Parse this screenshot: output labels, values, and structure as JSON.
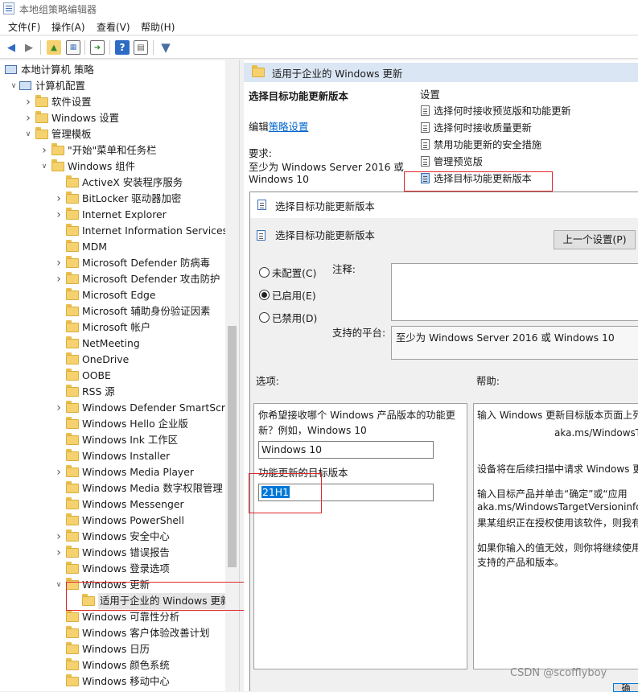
{
  "window": {
    "title": "本地组策略编辑器"
  },
  "menu": [
    "文件(F)",
    "操作(A)",
    "查看(V)",
    "帮助(H)"
  ],
  "toolbar": {
    "icons": [
      "back-arrow-icon",
      "forward-arrow-icon",
      "up-folder-icon",
      "show-hide-tree-icon",
      "export-list-icon",
      "help-icon",
      "properties-icon",
      "filter-icon"
    ]
  },
  "tree": {
    "items": [
      {
        "label": "本地计算机 策略",
        "level": 0,
        "expand": "",
        "icon": "computer"
      },
      {
        "label": "计算机配置",
        "level": 1,
        "expand": "v",
        "icon": "computer"
      },
      {
        "label": "软件设置",
        "level": 2,
        "expand": ">",
        "icon": "folder"
      },
      {
        "label": "Windows 设置",
        "level": 2,
        "expand": ">",
        "icon": "folder"
      },
      {
        "label": "管理模板",
        "level": 2,
        "expand": "v",
        "icon": "folder"
      },
      {
        "label": "\"开始\"菜单和任务栏",
        "level": 3,
        "expand": ">",
        "icon": "folder"
      },
      {
        "label": "Windows 组件",
        "level": 3,
        "expand": "v",
        "icon": "folder"
      },
      {
        "label": "ActiveX 安装程序服务",
        "level": 4,
        "expand": "",
        "icon": "folder"
      },
      {
        "label": "BitLocker 驱动器加密",
        "level": 4,
        "expand": ">",
        "icon": "folder"
      },
      {
        "label": "Internet Explorer",
        "level": 4,
        "expand": ">",
        "icon": "folder"
      },
      {
        "label": "Internet Information Services",
        "level": 4,
        "expand": "",
        "icon": "folder"
      },
      {
        "label": "MDM",
        "level": 4,
        "expand": "",
        "icon": "folder"
      },
      {
        "label": "Microsoft Defender 防病毒",
        "level": 4,
        "expand": ">",
        "icon": "folder"
      },
      {
        "label": "Microsoft Defender 攻击防护",
        "level": 4,
        "expand": ">",
        "icon": "folder"
      },
      {
        "label": "Microsoft Edge",
        "level": 4,
        "expand": "",
        "icon": "folder"
      },
      {
        "label": "Microsoft 辅助身份验证因素",
        "level": 4,
        "expand": "",
        "icon": "folder"
      },
      {
        "label": "Microsoft 帐户",
        "level": 4,
        "expand": "",
        "icon": "folder"
      },
      {
        "label": "NetMeeting",
        "level": 4,
        "expand": "",
        "icon": "folder"
      },
      {
        "label": "OneDrive",
        "level": 4,
        "expand": "",
        "icon": "folder"
      },
      {
        "label": "OOBE",
        "level": 4,
        "expand": "",
        "icon": "folder"
      },
      {
        "label": "RSS 源",
        "level": 4,
        "expand": "",
        "icon": "folder"
      },
      {
        "label": "Windows Defender SmartScree",
        "level": 4,
        "expand": ">",
        "icon": "folder"
      },
      {
        "label": "Windows Hello 企业版",
        "level": 4,
        "expand": "",
        "icon": "folder"
      },
      {
        "label": "Windows Ink 工作区",
        "level": 4,
        "expand": "",
        "icon": "folder"
      },
      {
        "label": "Windows Installer",
        "level": 4,
        "expand": "",
        "icon": "folder"
      },
      {
        "label": "Windows Media Player",
        "level": 4,
        "expand": ">",
        "icon": "folder"
      },
      {
        "label": "Windows Media 数字权限管理",
        "level": 4,
        "expand": "",
        "icon": "folder"
      },
      {
        "label": "Windows Messenger",
        "level": 4,
        "expand": "",
        "icon": "folder"
      },
      {
        "label": "Windows PowerShell",
        "level": 4,
        "expand": "",
        "icon": "folder"
      },
      {
        "label": "Windows 安全中心",
        "level": 4,
        "expand": ">",
        "icon": "folder"
      },
      {
        "label": "Windows 错误报告",
        "level": 4,
        "expand": ">",
        "icon": "folder"
      },
      {
        "label": "Windows 登录选项",
        "level": 4,
        "expand": "",
        "icon": "folder"
      },
      {
        "label": "Windows 更新",
        "level": 4,
        "expand": "v",
        "icon": "folder"
      },
      {
        "label": "适用于企业的 Windows 更新",
        "level": 5,
        "expand": "",
        "icon": "folder",
        "selected": true
      },
      {
        "label": "Windows 可靠性分析",
        "level": 4,
        "expand": "",
        "icon": "folder"
      },
      {
        "label": "Windows 客户体验改善计划",
        "level": 4,
        "expand": "",
        "icon": "folder"
      },
      {
        "label": "Windows 日历",
        "level": 4,
        "expand": "",
        "icon": "folder"
      },
      {
        "label": "Windows 颜色系统",
        "level": 4,
        "expand": "",
        "icon": "folder"
      },
      {
        "label": "Windows 移动中心",
        "level": 4,
        "expand": "",
        "icon": "folder"
      }
    ]
  },
  "right": {
    "header": "适用于企业的 Windows 更新",
    "policy_title": "选择目标功能更新版本",
    "edit_prefix": "编辑",
    "edit_link": "策略设置",
    "req_label": "要求:",
    "req_text_1": "至少为 Windows Server 2016 或",
    "req_text_2": "Windows 10",
    "settings_header": "设置",
    "settings": [
      "选择何时接收预览版和功能更新",
      "选择何时接收质量更新",
      "禁用功能更新的安全措施",
      "管理预览版",
      "选择目标功能更新版本"
    ]
  },
  "dialog": {
    "window_title": "选择目标功能更新版本",
    "setting_title": "选择目标功能更新版本",
    "prev_button": "上一个设置(P)",
    "radios": [
      "未配置(C)",
      "已启用(E)",
      "已禁用(D)"
    ],
    "selected_radio": "已启用(E)",
    "comment_label": "注释:",
    "platform_label": "支持的平台:",
    "platform_value": "至少为 Windows Server 2016 或 Windows 10",
    "options_label": "选项:",
    "help_label": "帮助:",
    "option_desc": "你希望接收哪个 Windows 产品版本的功能更新？例如，Windows 10",
    "product_value": "Windows 10",
    "target_label": "功能更新的目标版本",
    "target_value": "21H1",
    "help_lines": [
      "输入 Windows 更新目标版本页面上列",
      "aka.ms/WindowsT",
      "设备将在后续扫描中请求 Windows 更",
      "输入目标产品并单击“确定”或“应用",
      "aka.ms/WindowsTargetVersioninfo",
      "果某组织正在授权使用该软件，则我有",
      "如果你输入的值无效，则你将继续使用",
      "支持的产品和版本。"
    ],
    "ok_partial": "确"
  },
  "watermark": "CSDN @scofflyboy",
  "colors": {
    "highlight": "#0078d7",
    "redbox": "#e0262b",
    "link": "#0066cc",
    "header_bg": "#dbe6f4"
  }
}
